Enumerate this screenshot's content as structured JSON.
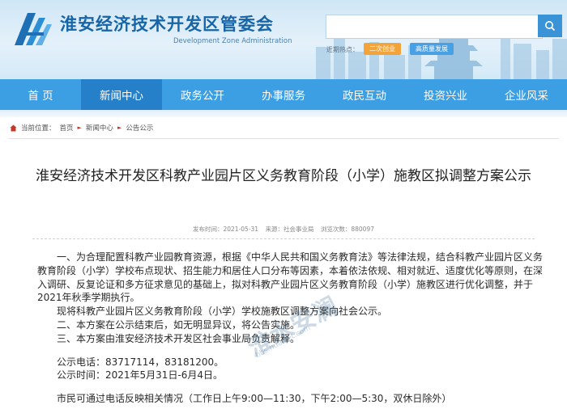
{
  "header": {
    "title": "淮安经济技术开发区管委会",
    "subtitle": "Development Zone Administration",
    "hot_label": "近期热点：",
    "hot_tags": [
      "二次创业",
      "高质量发展"
    ],
    "search_placeholder": ""
  },
  "nav": {
    "items": [
      "首 页",
      "新闻中心",
      "政务公开",
      "办事服务",
      "政民互动",
      "投资兴业",
      "企业风采"
    ],
    "active_index": 1
  },
  "breadcrumb": {
    "label": "当前位置：",
    "items": [
      "首页",
      "新闻中心",
      "公告公示"
    ]
  },
  "article": {
    "title": "淮安经济技术开发区科教产业园片区义务教育阶段（小学）施教区拟调整方案公示",
    "date": "发布时间：2021-05-31",
    "source": "来源：社会事业局",
    "views": "浏览次数：880097",
    "paragraph1": "一、为合理配置科教产业园教育资源，根据《中华人民共和国义务教育法》等法律法规，结合科教产业园片区义务教育阶段（小学）学校布点现状、招生能力和居住人口分布等因素，本着依法依规、相对就近、适度优化等原则，在深入调研、反复论证和多方征求意见的基础上，拟对科教产业园片区义务教育阶段（小学）施教区进行优化调整，并于2021年秋季学期执行。",
    "paragraph2": "现将科教产业园片区义务教育阶段（小学）学校施教区调整方案向社会公示。",
    "paragraph3": "二、本方案在公示结束后，如无明显异议，将公告实施。",
    "paragraph4": "三、本方案由淮安经济技术开发区社会事业局负责解释。",
    "phone": "公示电话：83717114，83181200。",
    "period": "公示时间：2021年5月31日-6月4日。",
    "closing": "市民可通过电话反映相关情况（工作日上午9:00—11:30，下午2:00—5:30，双休日除外）"
  },
  "watermark": {
    "text": "淮水安澜",
    "url": "bbs.huainet.com"
  },
  "colors": {
    "brand": "#1565a8",
    "nav": "#3c9ee3",
    "nav_active": "#2580c9",
    "tag_orange": "#f2a33a",
    "tag_blue": "#49a1e3"
  },
  "icons": [
    "logo-icon",
    "search-icon",
    "home-icon",
    "chevron-right-icon"
  ]
}
